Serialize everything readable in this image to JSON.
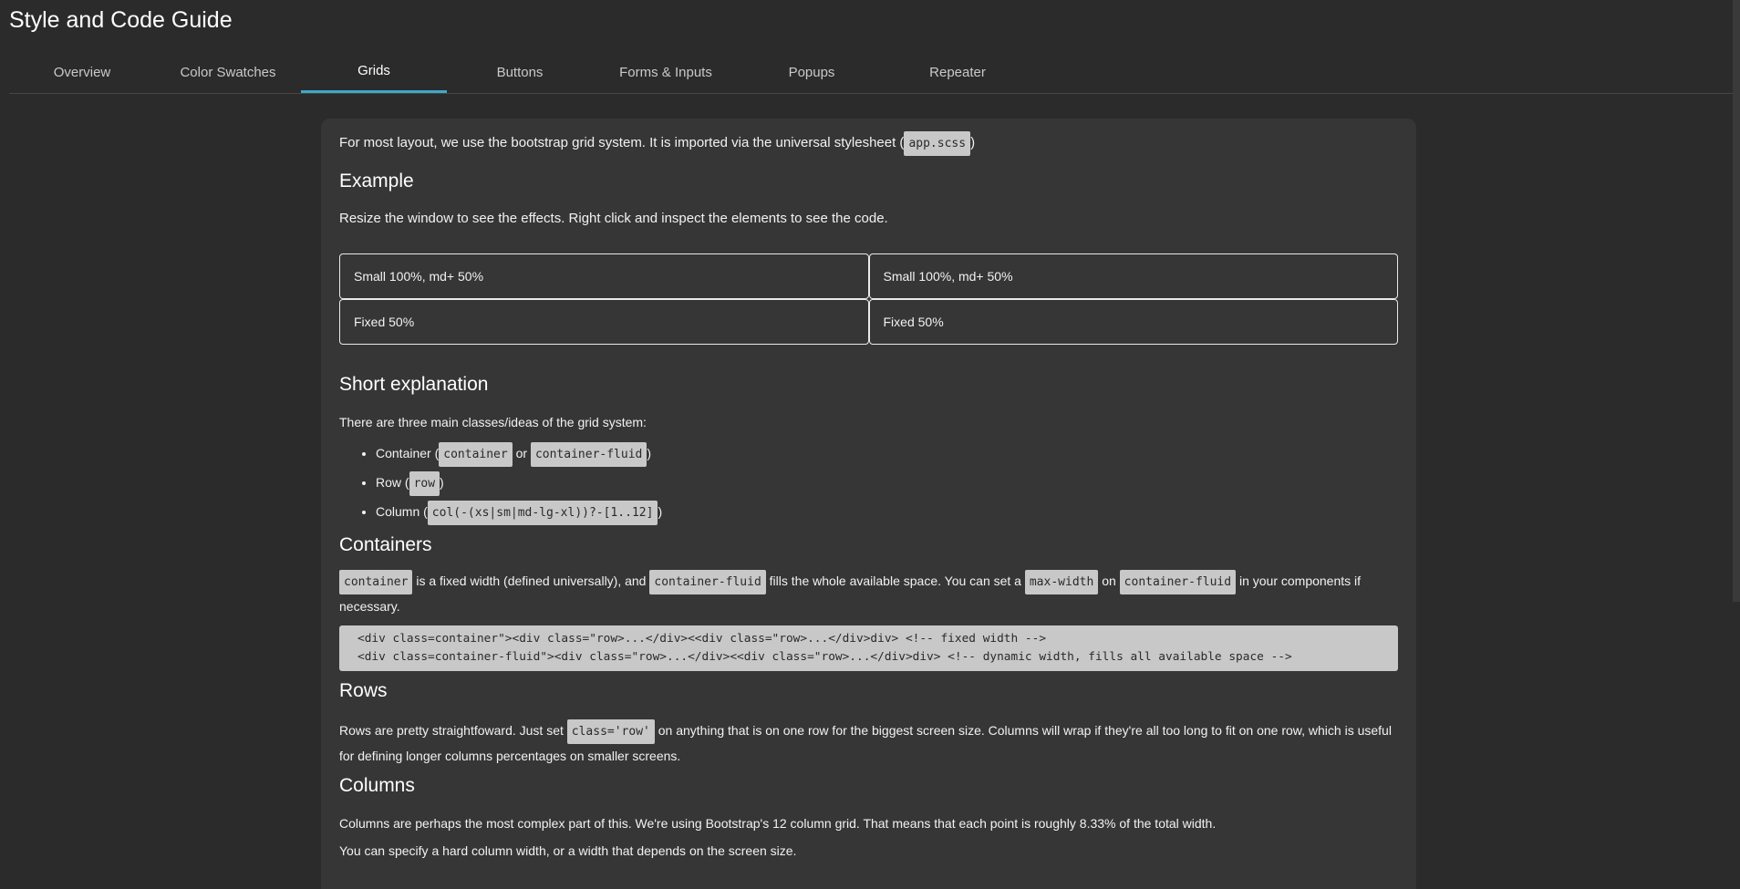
{
  "title": "Style and Code Guide",
  "tabs": [
    {
      "label": "Overview",
      "active": false
    },
    {
      "label": "Color Swatches",
      "active": false
    },
    {
      "label": "Grids",
      "active": true
    },
    {
      "label": "Buttons",
      "active": false
    },
    {
      "label": "Forms & Inputs",
      "active": false
    },
    {
      "label": "Popups",
      "active": false
    },
    {
      "label": "Repeater",
      "active": false
    }
  ],
  "accent_color": "#3fa9c9",
  "intro": {
    "text_before": "For most layout, we use the bootstrap grid system. It is imported via the universal stylesheet (",
    "code": "app.scss",
    "text_after": ")"
  },
  "example": {
    "heading": "Example",
    "text": "Resize the window to see the effects. Right click and inspect the elements to see the code.",
    "rows": [
      [
        "Small 100%, md+ 50%",
        "Small 100%, md+ 50%"
      ],
      [
        "Fixed 50%",
        "Fixed 50%"
      ]
    ]
  },
  "short_explanation": {
    "heading": "Short explanation",
    "text": "There are three main classes/ideas of the grid system:",
    "items": [
      {
        "label": "Container (",
        "code1": "container",
        "mid": "or",
        "code2": "container-fluid",
        "end": ")"
      },
      {
        "label": "Row (",
        "code1": "row",
        "end": ")"
      },
      {
        "label": "Column (",
        "code1": "col(-(xs|sm|md-lg-xl))?-[1..12]",
        "end": ")"
      }
    ]
  },
  "containers": {
    "heading": "Containers",
    "code_container": "container",
    "text1": " is a fixed width (defined universally), and ",
    "code_fluid": "container-fluid",
    "text2": " fills the whole available space. You can set a ",
    "code_maxwidth": "max-width",
    "text3": " on ",
    "code_fluid2": "container-fluid",
    "text4": " in your components if necessary.",
    "pre_line1": "<div class=container\"><div class=\"row>...</div><<div class=\"row>...</div>div> <!-- fixed width -->",
    "pre_line2": "<div class=container-fluid\"><div class=\"row>...</div><<div class=\"row>...</div>div> <!-- dynamic width, fills all available space -->"
  },
  "rows": {
    "heading": "Rows",
    "text1": "Rows are pretty straightfoward. Just set ",
    "code": "class='row'",
    "text2": " on anything that is on one row for the biggest screen size. Columns will wrap if they're all too long to fit on one row, which is useful for defining longer columns percentages on smaller screens."
  },
  "columns": {
    "heading": "Columns",
    "text1": "Columns are perhaps the most complex part of this. We're using Bootstrap's 12 column grid. That means that each point is roughly 8.33% of the total width.",
    "text2": "You can specify a hard column width, or a width that depends on the screen size."
  }
}
